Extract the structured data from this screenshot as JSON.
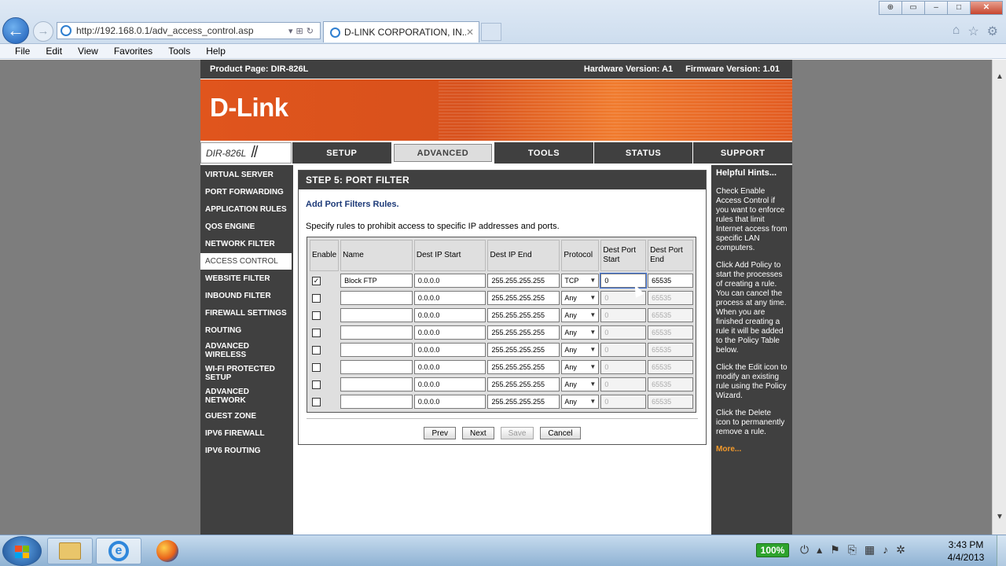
{
  "browser": {
    "url": "http://192.168.0.1/adv_access_control.asp",
    "tab_title": "D-LINK CORPORATION, IN...",
    "menu": [
      "File",
      "Edit",
      "View",
      "Favorites",
      "Tools",
      "Help"
    ],
    "window_buttons": {
      "minimize": "–",
      "maximize": "□",
      "close": "✕"
    }
  },
  "router": {
    "product_page": "Product Page: DIR-826L",
    "hardware_version": "Hardware Version: A1",
    "firmware_version": "Firmware Version: 1.01",
    "logo": "D-Link",
    "model": "DIR-826L",
    "nav_tabs": [
      "SETUP",
      "ADVANCED",
      "TOOLS",
      "STATUS",
      "SUPPORT"
    ],
    "active_tab": "ADVANCED",
    "sidebar": [
      "VIRTUAL SERVER",
      "PORT FORWARDING",
      "APPLICATION RULES",
      "QOS ENGINE",
      "NETWORK FILTER",
      "ACCESS CONTROL",
      "WEBSITE FILTER",
      "INBOUND FILTER",
      "FIREWALL SETTINGS",
      "ROUTING",
      "ADVANCED WIRELESS",
      "WI-FI PROTECTED SETUP",
      "ADVANCED NETWORK",
      "GUEST ZONE",
      "IPV6 FIREWALL",
      "IPV6 ROUTING"
    ],
    "active_sidebar": "ACCESS CONTROL",
    "step_title": "STEP 5: PORT FILTER",
    "heading": "Add Port Filters Rules.",
    "description": "Specify rules to prohibit access to specific IP addresses and ports.",
    "columns": {
      "enable": "Enable",
      "name": "Name",
      "dest_ip_start": "Dest IP Start",
      "dest_ip_end": "Dest IP End",
      "protocol": "Protocol",
      "dest_port_start": "Dest Port Start",
      "dest_port_end": "Dest Port End"
    },
    "rules": [
      {
        "enabled": true,
        "name": "Block FTP",
        "ip_start": "0.0.0.0",
        "ip_end": "255.255.255.255",
        "protocol": "TCP",
        "port_start": "0",
        "port_end": "65535"
      },
      {
        "enabled": false,
        "name": "",
        "ip_start": "0.0.0.0",
        "ip_end": "255.255.255.255",
        "protocol": "Any",
        "port_start": "0",
        "port_end": "65535"
      },
      {
        "enabled": false,
        "name": "",
        "ip_start": "0.0.0.0",
        "ip_end": "255.255.255.255",
        "protocol": "Any",
        "port_start": "0",
        "port_end": "65535"
      },
      {
        "enabled": false,
        "name": "",
        "ip_start": "0.0.0.0",
        "ip_end": "255.255.255.255",
        "protocol": "Any",
        "port_start": "0",
        "port_end": "65535"
      },
      {
        "enabled": false,
        "name": "",
        "ip_start": "0.0.0.0",
        "ip_end": "255.255.255.255",
        "protocol": "Any",
        "port_start": "0",
        "port_end": "65535"
      },
      {
        "enabled": false,
        "name": "",
        "ip_start": "0.0.0.0",
        "ip_end": "255.255.255.255",
        "protocol": "Any",
        "port_start": "0",
        "port_end": "65535"
      },
      {
        "enabled": false,
        "name": "",
        "ip_start": "0.0.0.0",
        "ip_end": "255.255.255.255",
        "protocol": "Any",
        "port_start": "0",
        "port_end": "65535"
      },
      {
        "enabled": false,
        "name": "",
        "ip_start": "0.0.0.0",
        "ip_end": "255.255.255.255",
        "protocol": "Any",
        "port_start": "0",
        "port_end": "65535"
      }
    ],
    "buttons": {
      "prev": "Prev",
      "next": "Next",
      "save": "Save",
      "cancel": "Cancel"
    },
    "hints_title": "Helpful Hints...",
    "hints": [
      "Check Enable Access Control if you want to enforce rules that limit Internet access from specific LAN computers.",
      "Click Add Policy to start the processes of creating a rule. You can cancel the process at any time. When you are finished creating a rule it will be added to the Policy Table below.",
      "Click the Edit icon to modify an existing rule using the Policy Wizard.",
      "Click the Delete icon to permanently remove a rule."
    ],
    "hints_more": "More..."
  },
  "taskbar": {
    "battery": "100%",
    "time": "3:43 PM",
    "date": "4/4/2013"
  }
}
